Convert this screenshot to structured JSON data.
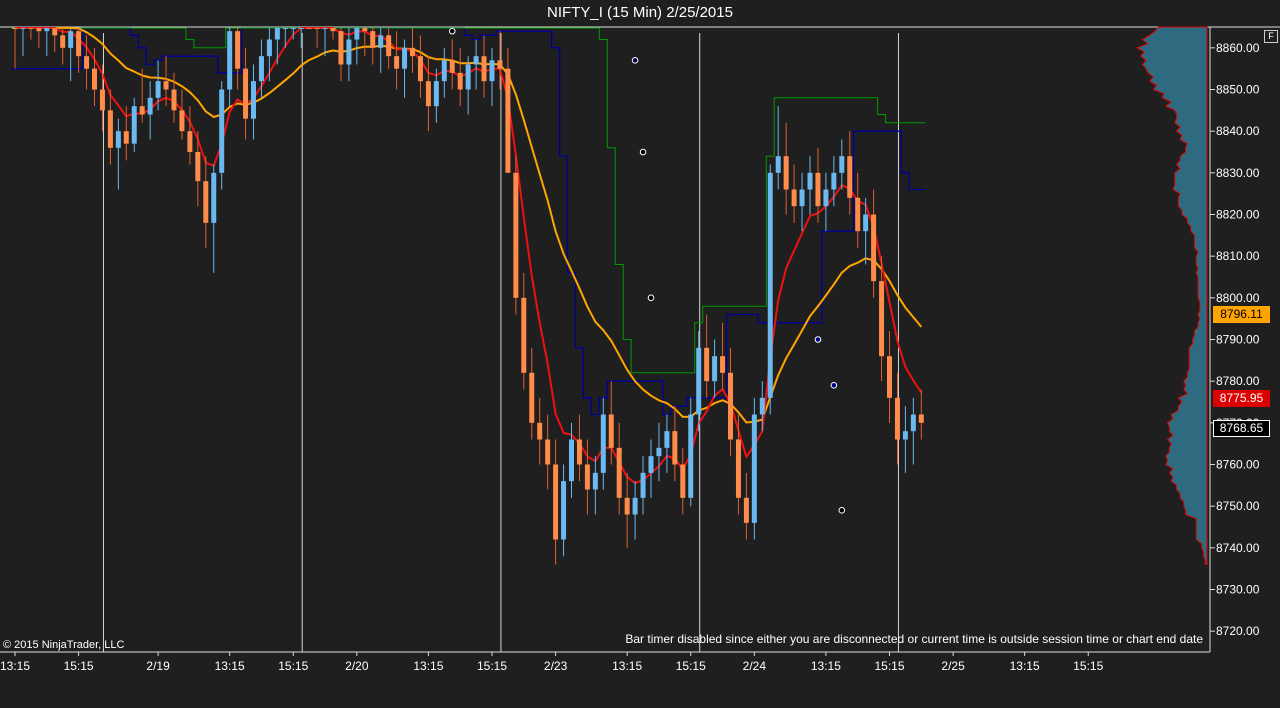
{
  "window": {
    "title": "NIFTY_I (15 Min)  2/25/2015",
    "copyright": "© 2015 NinjaTrader, LLC",
    "bar_timer_message": "Bar timer disabled since either you are disconnected or current time is outside session time or chart end date",
    "f_button": "F"
  },
  "price_labels": [
    {
      "text": "8796.11",
      "value": 8796.11,
      "bg": "#ffa500",
      "fg": "#000000",
      "border": "#ffa500"
    },
    {
      "text": "8775.95",
      "value": 8775.95,
      "bg": "#dd0000",
      "fg": "#ffffff",
      "border": "#dd0000"
    },
    {
      "text": "8768.65",
      "value": 8768.65,
      "bg": "#000000",
      "fg": "#ffffff",
      "border": "#ffffff"
    }
  ],
  "colors": {
    "background": "#1f1f1f",
    "up_candle": "#6cb8f0",
    "down_candle": "#ff8c4a",
    "wick_up": "#6cb8f0",
    "wick_down": "#e06030",
    "ema_fast": "#ee1111",
    "ema_slow": "#ffa500",
    "stop_line": "#000099",
    "green_line": "#009900",
    "volume_profile": "#2e6b80",
    "profile_edge": "#dd0000"
  },
  "chart_data": {
    "type": "candlestick",
    "title": "NIFTY_I (15 Min)  2/25/2015",
    "ylim": [
      8715,
      8865
    ],
    "y_ticks": [
      "8720.00",
      "8730.00",
      "8740.00",
      "8750.00",
      "8760.00",
      "8770.00",
      "8780.00",
      "8790.00",
      "8800.00",
      "8810.00",
      "8820.00",
      "8830.00",
      "8840.00",
      "8850.00",
      "8860.00"
    ],
    "x_ticks": [
      "13:15",
      "15:15",
      "2/19",
      "13:15",
      "15:15",
      "2/20",
      "13:15",
      "15:15",
      "2/23",
      "13:15",
      "15:15",
      "2/24",
      "13:15",
      "15:15",
      "2/25",
      "13:15",
      "15:15"
    ],
    "x_tick_bar_index": [
      0,
      8,
      18,
      27,
      35,
      43,
      52,
      60,
      68,
      77,
      85,
      93,
      102,
      110,
      118,
      127,
      135
    ],
    "session_break_bar_index": [
      11,
      36,
      61,
      86,
      111
    ],
    "bars_ohlc": [
      [
        8868,
        8870,
        8855,
        8866
      ],
      [
        8866,
        8872,
        8858,
        8870
      ],
      [
        8870,
        8874,
        8862,
        8868
      ],
      [
        8868,
        8871,
        8860,
        8864
      ],
      [
        8864,
        8869,
        8858,
        8866
      ],
      [
        8866,
        8870,
        8859,
        8863
      ],
      [
        8863,
        8868,
        8856,
        8860
      ],
      [
        8860,
        8866,
        8852,
        8864
      ],
      [
        8864,
        8867,
        8854,
        8858
      ],
      [
        8858,
        8863,
        8850,
        8855
      ],
      [
        8855,
        8860,
        8846,
        8850
      ],
      [
        8850,
        8856,
        8840,
        8845
      ],
      [
        8845,
        8850,
        8832,
        8836
      ],
      [
        8836,
        8843,
        8826,
        8840
      ],
      [
        8840,
        8846,
        8833,
        8837
      ],
      [
        8837,
        8848,
        8835,
        8846
      ],
      [
        8846,
        8855,
        8842,
        8844
      ],
      [
        8844,
        8852,
        8838,
        8848
      ],
      [
        8848,
        8857,
        8845,
        8852
      ],
      [
        8852,
        8858,
        8846,
        8850
      ],
      [
        8850,
        8854,
        8842,
        8845
      ],
      [
        8845,
        8850,
        8838,
        8840
      ],
      [
        8840,
        8846,
        8832,
        8835
      ],
      [
        8835,
        8840,
        8822,
        8828
      ],
      [
        8828,
        8834,
        8812,
        8818
      ],
      [
        8818,
        8832,
        8806,
        8830
      ],
      [
        8830,
        8852,
        8826,
        8850
      ],
      [
        8850,
        8868,
        8846,
        8864
      ],
      [
        8864,
        8870,
        8850,
        8855
      ],
      [
        8855,
        8860,
        8838,
        8843
      ],
      [
        8843,
        8856,
        8838,
        8852
      ],
      [
        8852,
        8862,
        8848,
        8858
      ],
      [
        8858,
        8866,
        8852,
        8862
      ],
      [
        8862,
        8870,
        8856,
        8866
      ],
      [
        8866,
        8872,
        8860,
        8868
      ],
      [
        8868,
        8875,
        8862,
        8870
      ],
      [
        8870,
        8880,
        8860,
        8875
      ],
      [
        8875,
        8882,
        8866,
        8870
      ],
      [
        8870,
        8876,
        8860,
        8866
      ],
      [
        8866,
        8872,
        8858,
        8869
      ],
      [
        8869,
        8874,
        8862,
        8864
      ],
      [
        8864,
        8868,
        8852,
        8856
      ],
      [
        8856,
        8866,
        8852,
        8862
      ],
      [
        8862,
        8870,
        8856,
        8866
      ],
      [
        8866,
        8872,
        8858,
        8864
      ],
      [
        8864,
        8869,
        8856,
        8860
      ],
      [
        8860,
        8866,
        8854,
        8863
      ],
      [
        8863,
        8868,
        8855,
        8858
      ],
      [
        8858,
        8864,
        8850,
        8855
      ],
      [
        8855,
        8862,
        8848,
        8860
      ],
      [
        8860,
        8866,
        8854,
        8858
      ],
      [
        8858,
        8863,
        8848,
        8852
      ],
      [
        8852,
        8858,
        8840,
        8846
      ],
      [
        8846,
        8855,
        8842,
        8852
      ],
      [
        8852,
        8860,
        8848,
        8857
      ],
      [
        8857,
        8862,
        8850,
        8854
      ],
      [
        8854,
        8860,
        8846,
        8850
      ],
      [
        8850,
        8858,
        8844,
        8856
      ],
      [
        8856,
        8862,
        8850,
        8858
      ],
      [
        8858,
        8863,
        8848,
        8852
      ],
      [
        8852,
        8860,
        8846,
        8857
      ],
      [
        8857,
        8864,
        8850,
        8855
      ],
      [
        8855,
        8860,
        8840,
        8830
      ],
      [
        8830,
        8834,
        8796,
        8800
      ],
      [
        8800,
        8806,
        8778,
        8782
      ],
      [
        8782,
        8788,
        8766,
        8770
      ],
      [
        8770,
        8776,
        8760,
        8766
      ],
      [
        8766,
        8772,
        8754,
        8760
      ],
      [
        8760,
        8766,
        8736,
        8742
      ],
      [
        8742,
        8760,
        8738,
        8756
      ],
      [
        8756,
        8770,
        8752,
        8766
      ],
      [
        8766,
        8772,
        8756,
        8760
      ],
      [
        8760,
        8766,
        8748,
        8754
      ],
      [
        8754,
        8762,
        8748,
        8758
      ],
      [
        8758,
        8776,
        8754,
        8772
      ],
      [
        8772,
        8780,
        8760,
        8764
      ],
      [
        8764,
        8770,
        8748,
        8752
      ],
      [
        8752,
        8758,
        8740,
        8748
      ],
      [
        8748,
        8756,
        8742,
        8752
      ],
      [
        8752,
        8762,
        8748,
        8758
      ],
      [
        8758,
        8766,
        8752,
        8762
      ],
      [
        8762,
        8770,
        8756,
        8764
      ],
      [
        8764,
        8772,
        8758,
        8768
      ],
      [
        8768,
        8774,
        8756,
        8760
      ],
      [
        8760,
        8764,
        8748,
        8752
      ],
      [
        8752,
        8776,
        8750,
        8772
      ],
      [
        8772,
        8792,
        8768,
        8788
      ],
      [
        8788,
        8796,
        8776,
        8780
      ],
      [
        8780,
        8790,
        8776,
        8786
      ],
      [
        8786,
        8794,
        8778,
        8782
      ],
      [
        8782,
        8788,
        8762,
        8766
      ],
      [
        8766,
        8772,
        8748,
        8752
      ],
      [
        8752,
        8758,
        8742,
        8746
      ],
      [
        8746,
        8776,
        8742,
        8772
      ],
      [
        8772,
        8780,
        8768,
        8776
      ],
      [
        8776,
        8832,
        8772,
        8830
      ],
      [
        8830,
        8846,
        8826,
        8834
      ],
      [
        8834,
        8842,
        8820,
        8826
      ],
      [
        8826,
        8832,
        8818,
        8822
      ],
      [
        8822,
        8830,
        8816,
        8826
      ],
      [
        8826,
        8834,
        8820,
        8830
      ],
      [
        8830,
        8836,
        8818,
        8822
      ],
      [
        8822,
        8830,
        8816,
        8826
      ],
      [
        8826,
        8834,
        8822,
        8830
      ],
      [
        8830,
        8838,
        8826,
        8834
      ],
      [
        8834,
        8840,
        8820,
        8824
      ],
      [
        8824,
        8830,
        8812,
        8816
      ],
      [
        8816,
        8824,
        8808,
        8820
      ],
      [
        8820,
        8826,
        8800,
        8804
      ],
      [
        8804,
        8810,
        8780,
        8786
      ],
      [
        8786,
        8792,
        8770,
        8776
      ],
      [
        8776,
        8782,
        8760,
        8766
      ],
      [
        8766,
        8774,
        8758,
        8768
      ],
      [
        8768,
        8776,
        8760,
        8772
      ],
      [
        8772,
        8778,
        8766,
        8770
      ]
    ],
    "bars_note": "Values read approximately from the chart axes (price units).",
    "ema_fast_values": [],
    "price_markers": [
      8796.11,
      8775.95,
      8768.65
    ]
  }
}
